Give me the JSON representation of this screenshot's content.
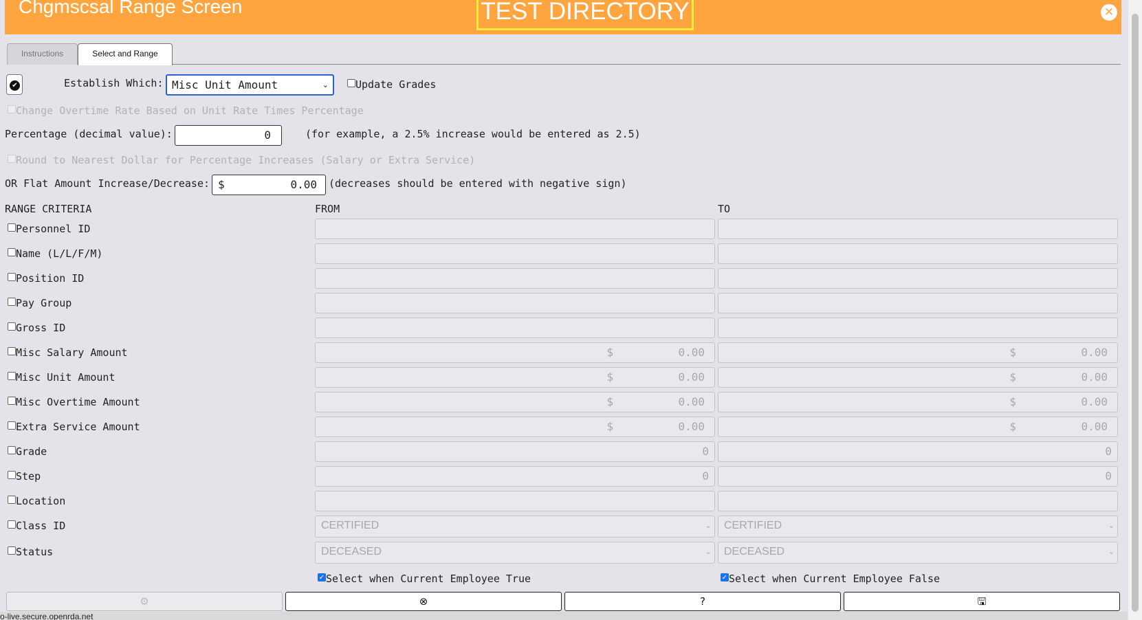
{
  "header": {
    "title": "Chgmscsal Range Screen",
    "directory": "TEST DIRECTORY",
    "close_icon": "close-circle-icon"
  },
  "tabs": [
    {
      "label": "Instructions"
    },
    {
      "label": "Select and Range"
    }
  ],
  "establish": {
    "label": "Establish Which:",
    "selected": "Misc Unit Amount"
  },
  "update_grades": {
    "label": "Update Grades",
    "checked": false
  },
  "overtime_rate": {
    "label": "Change Overtime Rate Based on Unit Rate Times Percentage",
    "disabled": true
  },
  "percentage": {
    "label": "Percentage (decimal value):",
    "value": "0",
    "hint": "(for example, a 2.5% increase would be entered as 2.5)"
  },
  "round_dollar": {
    "label": "Round to Nearest Dollar for Percentage Increases (Salary or Extra Service)",
    "disabled": true
  },
  "flat_amount": {
    "label": "OR Flat Amount Increase/Decrease:",
    "currency": "$",
    "value": "0.00",
    "hint": "(decreases should be entered with negative sign)"
  },
  "range": {
    "header": "RANGE CRITERIA",
    "from": "FROM",
    "to": "TO",
    "rows": [
      {
        "label": "Personnel ID",
        "type": "text",
        "from": "",
        "to": ""
      },
      {
        "label": "Name (L/L/F/M)",
        "type": "text",
        "from": "",
        "to": ""
      },
      {
        "label": "Position ID",
        "type": "text",
        "from": "",
        "to": ""
      },
      {
        "label": "Pay Group",
        "type": "text",
        "from": "",
        "to": ""
      },
      {
        "label": "Gross ID",
        "type": "text",
        "from": "",
        "to": ""
      },
      {
        "label": "Misc Salary Amount",
        "type": "money",
        "currency": "$",
        "from": "0.00",
        "to": "0.00"
      },
      {
        "label": "Misc Unit Amount",
        "type": "money",
        "currency": "$",
        "from": "0.00",
        "to": "0.00"
      },
      {
        "label": "Misc Overtime Amount",
        "type": "money",
        "currency": "$",
        "from": "0.00",
        "to": "0.00"
      },
      {
        "label": "Extra Service Amount",
        "type": "money",
        "currency": "$",
        "from": "0.00",
        "to": "0.00"
      },
      {
        "label": "Grade",
        "type": "int",
        "from": "0",
        "to": "0"
      },
      {
        "label": "Step",
        "type": "int",
        "from": "0",
        "to": "0"
      },
      {
        "label": "Location",
        "type": "text",
        "from": "",
        "to": ""
      },
      {
        "label": "Class ID",
        "type": "select",
        "from": "CERTIFIED",
        "to": "CERTIFIED"
      },
      {
        "label": "Status",
        "type": "select",
        "from": "DECEASED",
        "to": "DECEASED"
      }
    ]
  },
  "current_true": {
    "label": "Select when Current Employee True",
    "checked": true
  },
  "current_false": {
    "label": "Select when Current Employee False",
    "checked": true
  },
  "footer_buttons": [
    {
      "icon": "gear-icon",
      "glyph": "⚙"
    },
    {
      "icon": "close-circle-icon",
      "glyph": "⊗"
    },
    {
      "icon": "help-icon",
      "glyph": "?"
    },
    {
      "icon": "save-icon",
      "glyph": "🖫"
    }
  ],
  "statusbar_text": "o-live.secure.openrda.net",
  "colors": {
    "header": "#fea53f",
    "directory_border": "#f4ee3a",
    "select_border": "#2a62d6"
  }
}
